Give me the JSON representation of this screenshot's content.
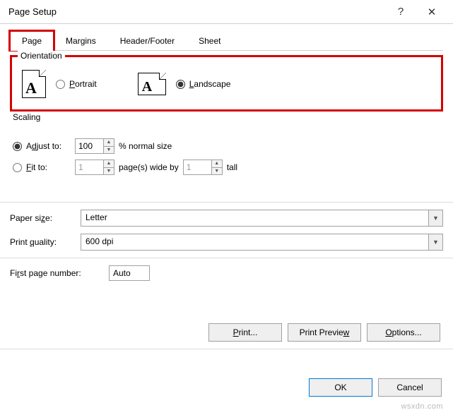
{
  "window": {
    "title": "Page Setup"
  },
  "tabs": [
    "Page",
    "Margins",
    "Header/Footer",
    "Sheet"
  ],
  "active_tab": 0,
  "orientation": {
    "legend": "Orientation",
    "portrait_label": "Portrait",
    "landscape_label": "Landscape",
    "selected": "landscape"
  },
  "scaling": {
    "legend": "Scaling",
    "adjust_label_pre": "A",
    "adjust_label_u": "d",
    "adjust_label_post": "just to:",
    "adjust_value": "100",
    "adjust_suffix": "% normal size",
    "fit_label_pre": "",
    "fit_label_u": "F",
    "fit_label_post": "it to:",
    "fit_wide": "1",
    "fit_mid": "page(s) wide by",
    "fit_tall": "1",
    "fit_suffix": "tall",
    "selected": "adjust"
  },
  "paper": {
    "size_label": "Paper size:",
    "size_value": "Letter",
    "quality_label": "Print quality:",
    "quality_value": "600 dpi"
  },
  "first_page": {
    "label": "First page number:",
    "value": "Auto"
  },
  "buttons": {
    "print": "Print...",
    "preview": "Print Preview",
    "options": "Options...",
    "ok": "OK",
    "cancel": "Cancel"
  },
  "watermark": "wsxdn.com"
}
